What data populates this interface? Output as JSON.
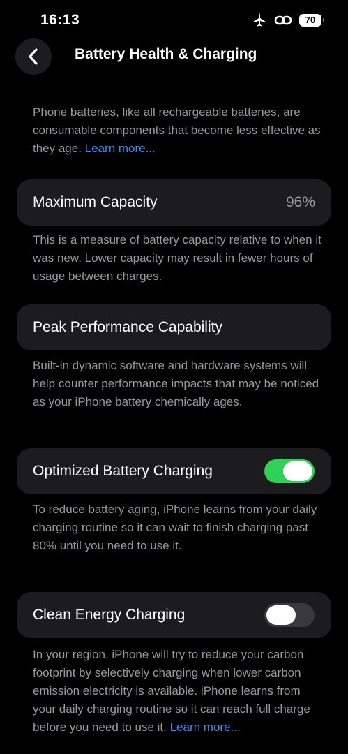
{
  "status_bar": {
    "time": "16:13",
    "battery_level": "70",
    "icons": [
      "airplane-icon",
      "link-icon",
      "battery-icon"
    ]
  },
  "nav": {
    "title": "Battery Health & Charging",
    "back_icon": "chevron-left-icon"
  },
  "intro": {
    "text": "Phone batteries, like all rechargeable batteries, are consumable components that become less effective as they age. ",
    "link": "Learn more..."
  },
  "maximum_capacity": {
    "label": "Maximum Capacity",
    "value": "96%",
    "description": "This is a measure of battery capacity relative to when it was new. Lower capacity may result in fewer hours of usage between charges."
  },
  "peak_performance": {
    "label": "Peak Performance Capability",
    "description": "Built-in dynamic software and hardware systems will help counter performance impacts that may be noticed as your iPhone battery chemically ages."
  },
  "optimized_charging": {
    "label": "Optimized Battery Charging",
    "enabled": true,
    "description": "To reduce battery aging, iPhone learns from your daily charging routine so it can wait to finish charging past 80% until you need to use it."
  },
  "clean_energy": {
    "label": "Clean Energy Charging",
    "enabled": false,
    "description": "In your region, iPhone will try to reduce your carbon footprint by selectively charging when lower carbon emission electricity is available. iPhone learns from your daily charging routine so it can reach full charge before you need to use it. ",
    "link": "Learn more..."
  },
  "colors": {
    "background": "#000000",
    "card": "#1c1c1e",
    "secondary_text": "#98989f",
    "link": "#3a8cff",
    "toggle_on": "#30d158",
    "toggle_off": "#39393d"
  }
}
